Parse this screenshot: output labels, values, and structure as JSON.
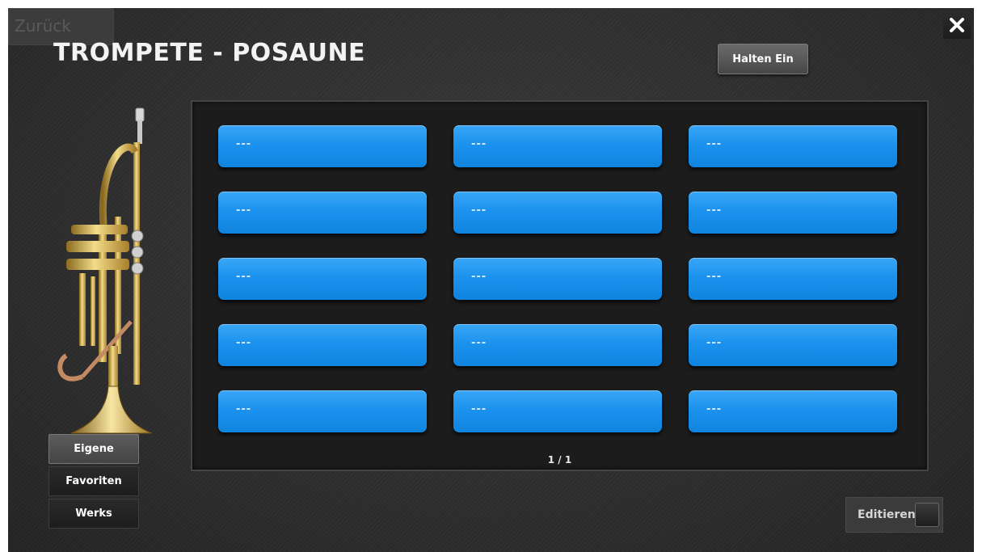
{
  "header": {
    "title": "TROMPETE - POSAUNE",
    "hold_button": "Halten Ein",
    "back_button": "Zurück",
    "close_icon": "close-icon"
  },
  "categories": {
    "own": "Eigene",
    "favorites": "Favoriten",
    "factory": "Werks",
    "selected": "Eigene"
  },
  "slots": {
    "s0": "---",
    "s1": "---",
    "s2": "---",
    "s3": "---",
    "s4": "---",
    "s5": "---",
    "s6": "---",
    "s7": "---",
    "s8": "---",
    "s9": "---",
    "s10": "---",
    "s11": "---",
    "s12": "---",
    "s13": "---",
    "s14": "---"
  },
  "pagination": {
    "indicator": "1 / 1"
  },
  "footer": {
    "edit_label": "Editieren"
  },
  "colors": {
    "slot_blue": "#1b93ee",
    "background": "#2f2f2f",
    "panel": "#1c1c1c"
  },
  "image": {
    "instrument": "trumpet-image"
  }
}
